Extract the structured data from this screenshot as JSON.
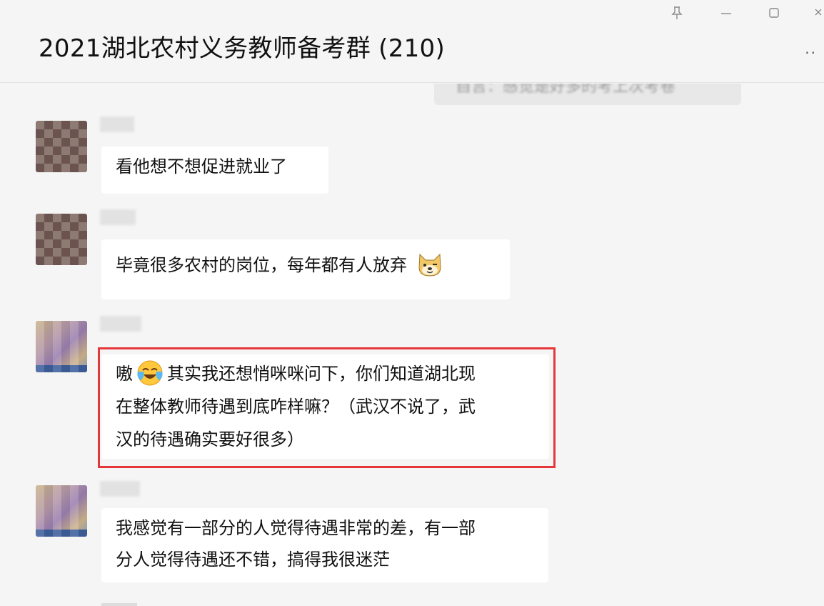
{
  "window": {
    "title": "2021湖北农村义务教师备考群 (210)",
    "controls": {
      "pin_icon": "pin-icon",
      "minimize_icon": "minimize-icon",
      "maximize_icon": "maximize-icon",
      "close_icon": "close-icon"
    },
    "more_label": "··"
  },
  "self_message": "自言：感觉是好多的考上次考卷",
  "messages": [
    {
      "text": "看他想不想促进就业了",
      "avatar": "dark"
    },
    {
      "text": "毕竟很多农村的岗位，每年都有人放弃",
      "avatar": "dark",
      "emoji": "doge-emoji"
    },
    {
      "prefix": "嗷",
      "emoji": "laughing-tears-emoji",
      "line1": "其实我还想悄咪咪问下，你们知道湖北现",
      "line2": "在整体教师待遇到底咋样嘛？（武汉不说了，武",
      "line3": "汉的待遇确实要好很多）",
      "avatar": "light",
      "highlighted": true
    },
    {
      "line1": "我感觉有一部分的人觉得待遇非常的差，有一部",
      "line2": "分人觉得待遇还不错，搞得我很迷茫",
      "avatar": "light"
    }
  ],
  "colors": {
    "highlight_border": "#e5373b",
    "bubble": "#ffffff",
    "background": "#f5f5f5"
  }
}
